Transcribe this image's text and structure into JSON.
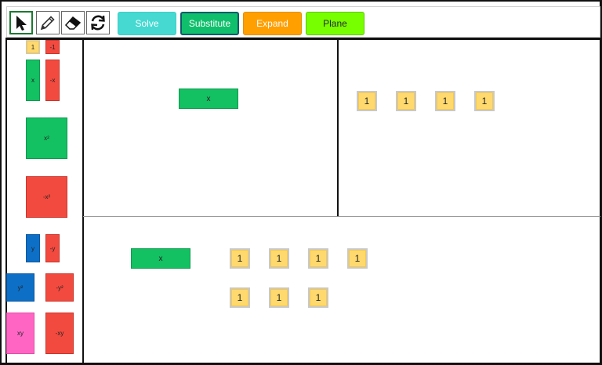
{
  "toolbar": {
    "tools": [
      "pointer-icon",
      "pencil-icon",
      "eraser-icon",
      "refresh-icon"
    ],
    "buttons": {
      "solve": "Solve",
      "substitute": "Substitute",
      "expand": "Expand",
      "plane": "Plane"
    },
    "colors": {
      "solve": "#45d9d1",
      "substitute": "#0fbf6b",
      "expand": "#ff9f00",
      "plane": "#77ff00"
    }
  },
  "palette": {
    "one": "1",
    "neg_one": "-1",
    "x": "x",
    "neg_x": "-x",
    "x2": "x²",
    "neg_x2": "-x²",
    "y": "y",
    "neg_y": "-y",
    "y2": "y²",
    "neg_y2": "-y²",
    "xy": "xy",
    "neg_xy": "-xy"
  },
  "workspace": {
    "top_left": {
      "x_tile": "x"
    },
    "top_right": {
      "ones": [
        "1",
        "1",
        "1",
        "1"
      ]
    },
    "bottom": {
      "x_tile": "x",
      "ones_row1": [
        "1",
        "1",
        "1",
        "1"
      ],
      "ones_row2": [
        "1",
        "1",
        "1"
      ]
    }
  }
}
